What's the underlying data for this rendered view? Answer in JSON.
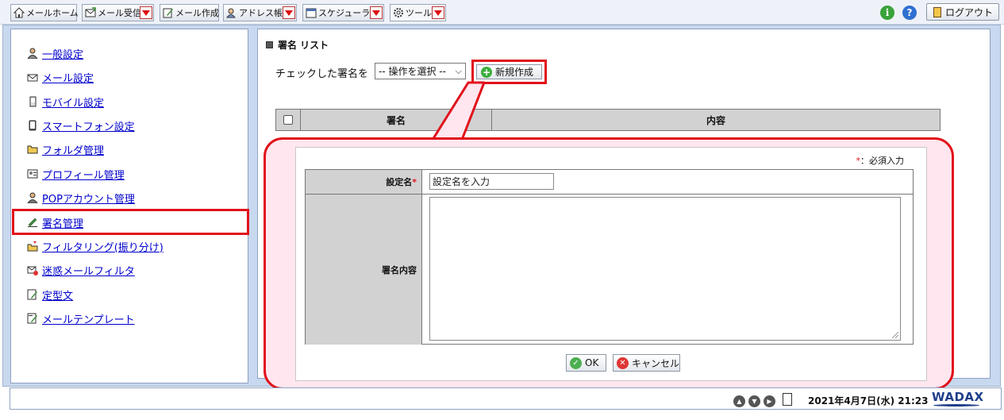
{
  "toolbar": {
    "mail_home": "メールホーム",
    "mail_receive": "メール受信",
    "mail_compose": "メール作成",
    "address_book": "アドレス帳",
    "scheduler": "スケジューラ",
    "tools": "ツール",
    "info_icon_glyph": "i",
    "help_icon_glyph": "?",
    "logout": "ログアウト"
  },
  "sidebar": {
    "items": [
      {
        "label": "一般設定",
        "icon": "user-icon"
      },
      {
        "label": "メール設定",
        "icon": "mail-settings-icon"
      },
      {
        "label": "モバイル設定",
        "icon": "mobile-icon"
      },
      {
        "label": "スマートフォン設定",
        "icon": "smartphone-icon"
      },
      {
        "label": "フォルダ管理",
        "icon": "folder-icon"
      },
      {
        "label": "プロフィール管理",
        "icon": "profile-icon"
      },
      {
        "label": "POPアカウント管理",
        "icon": "pop-account-icon"
      },
      {
        "label": "署名管理",
        "icon": "signature-icon",
        "active": true
      },
      {
        "label": "フィルタリング(振り分け)",
        "icon": "filter-icon"
      },
      {
        "label": "迷惑メールフィルタ",
        "icon": "spam-filter-icon"
      },
      {
        "label": "定型文",
        "icon": "template-text-icon"
      },
      {
        "label": "メールテンプレート",
        "icon": "mail-template-icon"
      }
    ]
  },
  "main": {
    "title": "署名 リスト",
    "operation_label": "チェックした署名を",
    "operation_select": "-- 操作を選択 --",
    "new_button": "新規作成",
    "list_headers": [
      "署名",
      "内容"
    ]
  },
  "dialog": {
    "required_star": "*",
    "required_note": "：必須入力",
    "name_label": "設定名",
    "name_placeholder": "設定名を入力",
    "content_label": "署名内容",
    "content_value": "",
    "ok_button": "OK",
    "cancel_button": "キャンセル"
  },
  "status": {
    "datetime": "2021年4月7日(水) 21:23",
    "brand": "WADAX"
  },
  "colors": {
    "highlight": "#e1121b",
    "callout_bg": "#ffe6ef",
    "link": "#0000cc",
    "frame_bg": "#c8d8ee"
  }
}
